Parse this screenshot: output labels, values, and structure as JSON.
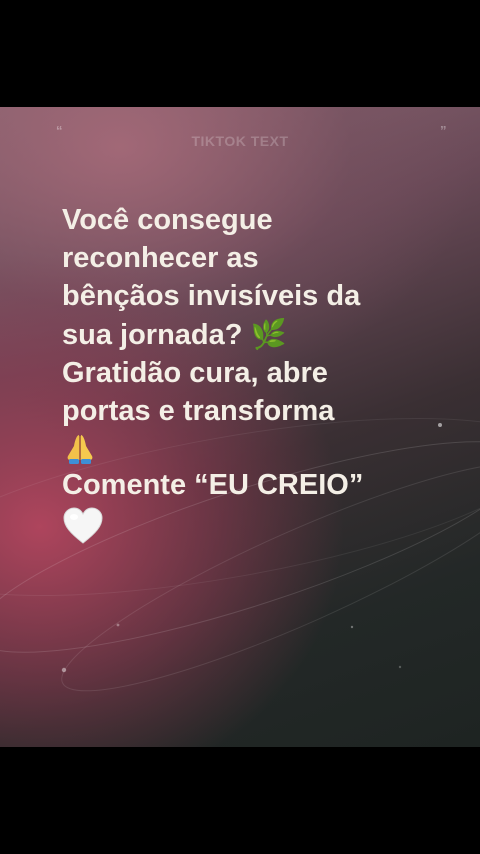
{
  "brand": {
    "label": "TIKTOK TEXT"
  },
  "quote_marks": {
    "open": "“",
    "close": "”"
  },
  "post": {
    "lines": [
      "Você consegue",
      "reconhecer as",
      "bênçãos invisíveis da",
      "sua jornada?",
      "Gratidão cura, abre",
      "portas e transforma",
      "Comente “EU CREIO”"
    ],
    "emoji_leaf": "🌿",
    "emoji_pray": "🙏",
    "emoji_heart": "🤍"
  },
  "colors": {
    "text": "#f4efe6",
    "bg_pink": "#b4465f",
    "bg_dark": "#1e2422"
  }
}
